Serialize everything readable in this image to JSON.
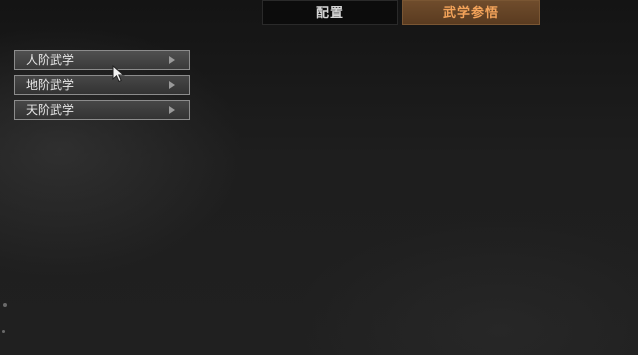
{
  "tabs": {
    "config_label": "配置",
    "martial_label": "武学参悟"
  },
  "menu": {
    "items": [
      {
        "label": "人阶武学"
      },
      {
        "label": "地阶武学"
      },
      {
        "label": "天阶武学"
      }
    ]
  },
  "colors": {
    "active_tab_bg": "#6f4c2c",
    "active_tab_text": "#f3a35a",
    "menu_border": "#8c8c8c"
  },
  "icons": {
    "cursor": "mouse-pointer-icon",
    "submenu_arrow": "chevron-right-icon"
  }
}
